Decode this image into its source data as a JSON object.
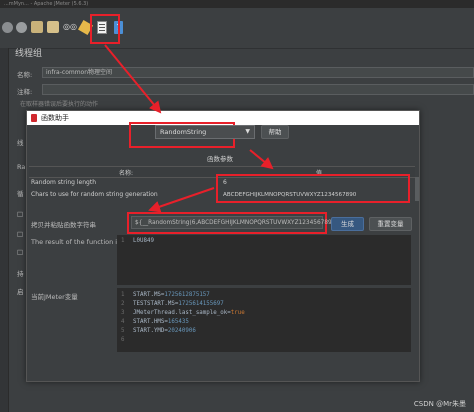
{
  "window": {
    "title": "...mMyn... - Apache JMeter (5.6.3)"
  },
  "panel": {
    "title": "线程组",
    "name_label": "名称:",
    "name_value": "infra-common物理空间",
    "comment_label": "注释:",
    "truncated_text": "在取样器错误后要执行的动作",
    "side_label_1": "线",
    "side_label_2": "Ra",
    "side_label_3": "循",
    "side_label_4": "□",
    "side_label_5": "□",
    "side_label_6": "□",
    "side_label_7": "持",
    "side_label_8": "启"
  },
  "dialog": {
    "title": "函数助手",
    "function_select": "RandomString",
    "help_button": "帮助",
    "params_header": "函数参数",
    "col_name": "名称:",
    "col_value": "值",
    "params": [
      {
        "name": "Random string length",
        "value": "6"
      },
      {
        "name": "Chars to use for random string generation",
        "value": "ABCDEFGHIJKLMNOPQRSTUVWXYZ1234567890"
      }
    ],
    "copy_label": "拷贝并粘贴函数字符串",
    "function_string": "${__RandomString(6,ABCDEFGHIJKLMNOPQRSTUVWXYZ1234567890,)}",
    "generate_button": "生成",
    "reset_button": "重置变量",
    "result_label": "The result of the function is",
    "result_gutter": "1",
    "result_value": "L0U849",
    "vars_label": "当前JMeter变量",
    "vars": [
      {
        "line": "1",
        "key": "START.MS=",
        "val": "1725612875157",
        "type": "num"
      },
      {
        "line": "2",
        "key": "TESTSTART.MS=",
        "val": "1725614155697",
        "type": "num"
      },
      {
        "line": "3",
        "key": "JMeterThread.last_sample_ok=",
        "val": "true",
        "type": "kw"
      },
      {
        "line": "4",
        "key": "START.HMS=",
        "val": "165435",
        "type": "num"
      },
      {
        "line": "5",
        "key": "START.YMD=",
        "val": "20240906",
        "type": "num"
      },
      {
        "line": "6",
        "key": "",
        "val": "",
        "type": "none"
      }
    ]
  },
  "watermark": "CSDN @Mr朱墨",
  "colors": {
    "highlight": "#e8202a",
    "primary_button": "#365880"
  }
}
